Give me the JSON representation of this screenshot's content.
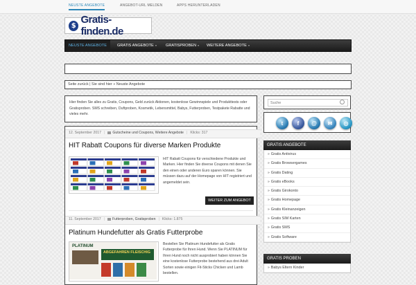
{
  "topbar": {
    "links": [
      "NEUSTE ANGEBOTE",
      "ANGEBOT-URL MELDEN",
      "APPS HERUNTERLADEN"
    ]
  },
  "logo": {
    "text": "Gratis-finden.de",
    "icon": "dollar-coin-icon"
  },
  "nav": {
    "items": [
      {
        "label": "NEUSTE ANGEBOTE",
        "active": true
      },
      {
        "label": "GRATIS ANGEBOTE",
        "arrow": "»"
      },
      {
        "label": "GRATISPROBEN",
        "arrow": "»"
      },
      {
        "label": "WEITERE ANGEBOTE",
        "arrow": "»"
      }
    ]
  },
  "breadcrumb": {
    "text": "Seite zurück | Sie sind hier » Neuste Angebote"
  },
  "intro": {
    "text": "Hier finden Sie alles zu Gratis, Coupons, Geld zurück Aktionen, kostenlose Gewinnspiele und Produkttests oder Gratisproben. SMS schreiben, Duftproben, Kosmetik, Lebensmittel, Babys, Futterproben, Testpakete Rabatte und vieles mehr."
  },
  "posts": [
    {
      "date": "12. September 2017",
      "categories": "Gutscheine und Coupons, Weitere Angebote",
      "clicks": "Klicks: 317",
      "title": "HIT Rabatt Coupons für diverse Marken Produkte",
      "excerpt": "HIT Rabatt Coupons für verschiedene Produkte und Marken. Hier finden Sie diverse Coupons mit denen Sie den einen oder anderen Euro sparen können. Sie müssen dazu auf der Homepage von HIT registriert und angemeldet sein.",
      "more": "WEITER ZUM ANGEBOT"
    },
    {
      "date": "11. September 2017",
      "categories": "Futterproben, Gratisproben",
      "clicks": "Klicks: 1.875",
      "title": "Platinum Hundefutter als Gratis Futterprobe",
      "excerpt": "Bestellen Sie Platinum Hundefutter als Gratis Futterprobe für Ihren Hund. Wenn Sie PLATINUM für Ihren Hund noch nicht ausprobiert haben können Sie eine kostenlose Futterprobe bestehend aus drei Adult Sorten sowie einigen Fit-Sticks Chicken und Lamb bestellen.",
      "thumb_brand": "PLATINUM",
      "thumb_banner": "ABGEFAHREN FLEISCHIG"
    }
  ],
  "search": {
    "placeholder": "Suche"
  },
  "socials": [
    "twitter-icon",
    "facebook-icon",
    "email-icon",
    "mail-icon",
    "rss-icon"
  ],
  "sidebar": {
    "angebote_title": "GRATIS ANGEBOTE",
    "angebote": [
      "Gratis Antivirus",
      "Gratis Browsergames",
      "Gratis Dating",
      "Gratis eBooks",
      "Gratis Girokonto",
      "Gratis Homepage",
      "Gratis Kleinanzeigen",
      "Gratis SIM Karten",
      "Gratis SMS",
      "Gratis Software"
    ],
    "proben_title": "GRATIS PROBEN",
    "proben": [
      "Babys Eltern Kinder"
    ]
  },
  "colors": {
    "accent": "#2a86b8",
    "nav_dark": "#222222"
  }
}
